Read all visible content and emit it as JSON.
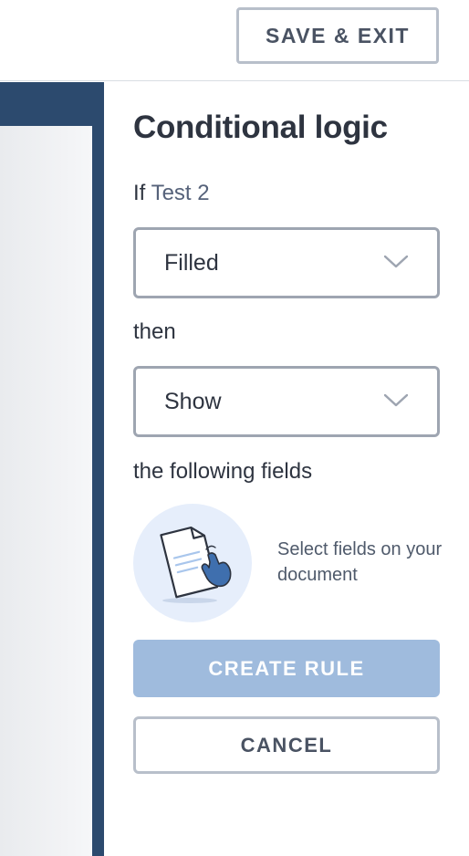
{
  "header": {
    "save_exit_label": "SAVE & EXIT"
  },
  "panel": {
    "title": "Conditional logic",
    "if_prefix": "If",
    "field_name": "Test 2",
    "condition_select": {
      "value": "Filled",
      "icon": "chevron-down-icon"
    },
    "then_label": "then",
    "action_select": {
      "value": "Show",
      "icon": "chevron-down-icon"
    },
    "following_label": "the following fields",
    "illustration_icon": "document-tap-icon",
    "hint_text": "Select fields on your document",
    "create_rule_label": "CREATE RULE",
    "cancel_label": "CANCEL"
  },
  "colors": {
    "canvas_border": "#2c4a6e",
    "create_rule_disabled": "#9fbbdd",
    "hand_accent": "#3f6fae",
    "illustration_bg": "#e6eefb"
  }
}
